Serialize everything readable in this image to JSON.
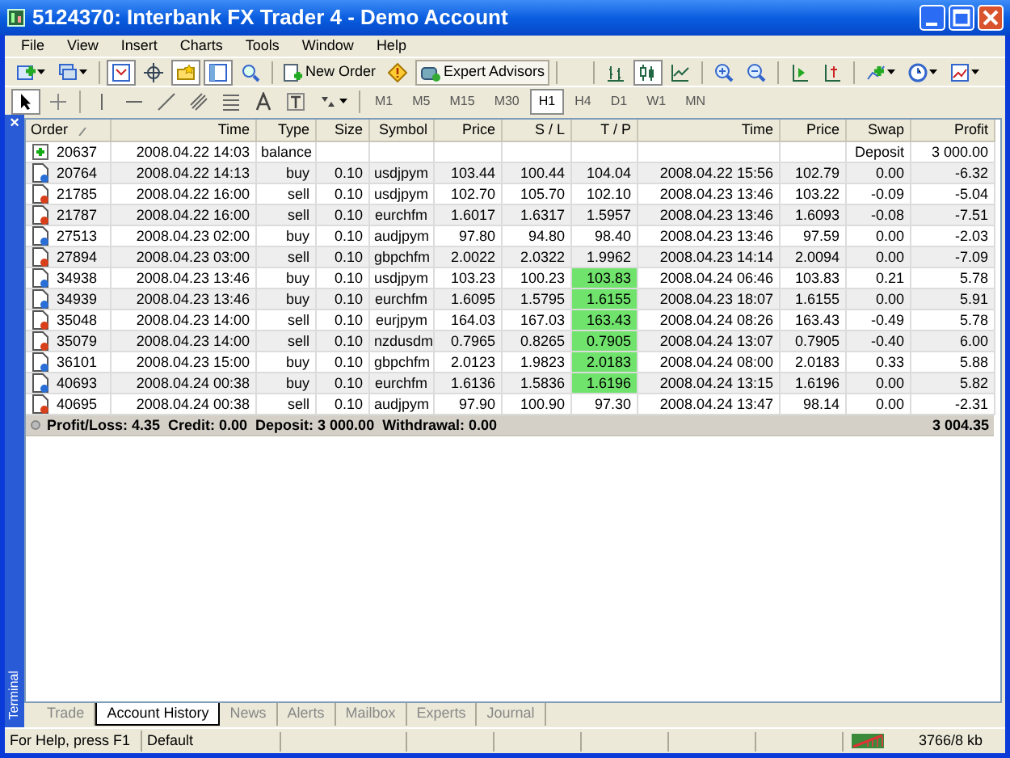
{
  "window": {
    "title": "5124370: Interbank FX Trader 4 - Demo Account"
  },
  "menu": [
    "File",
    "View",
    "Insert",
    "Charts",
    "Tools",
    "Window",
    "Help"
  ],
  "toolbar": {
    "new_order": "New Order",
    "expert_advisors": "Expert Advisors",
    "chart_modes": [
      {
        "selected": false
      },
      {
        "selected": true
      },
      {
        "selected": false
      }
    ],
    "cursor_tools": [
      {
        "selected": true
      },
      {
        "selected": false
      }
    ],
    "timeframes": [
      {
        "label": "M1",
        "selected": false
      },
      {
        "label": "M5",
        "selected": false
      },
      {
        "label": "M15",
        "selected": false
      },
      {
        "label": "M30",
        "selected": false
      },
      {
        "label": "H1",
        "selected": true
      },
      {
        "label": "H4",
        "selected": false
      },
      {
        "label": "D1",
        "selected": false
      },
      {
        "label": "W1",
        "selected": false
      },
      {
        "label": "MN",
        "selected": false
      }
    ]
  },
  "terminal": {
    "label": "Terminal",
    "close": "×",
    "columns": [
      {
        "label": "Order",
        "sorted": true
      },
      {
        "label": "Time",
        "sorted": false
      },
      {
        "label": "Type",
        "sorted": false
      },
      {
        "label": "Size",
        "sorted": false
      },
      {
        "label": "Symbol",
        "sorted": false
      },
      {
        "label": "Price",
        "sorted": false
      },
      {
        "label": "S / L",
        "sorted": false
      },
      {
        "label": "T / P",
        "sorted": false
      },
      {
        "label": "Time",
        "sorted": false
      },
      {
        "label": "Price",
        "sorted": false
      },
      {
        "label": "Swap",
        "sorted": false
      },
      {
        "label": "Profit",
        "sorted": false
      }
    ],
    "rows": [
      {
        "kind": "balance",
        "order": "20637",
        "time": "2008.04.22 14:03",
        "type": "balance",
        "swap": "Deposit",
        "profit": "3 000.00"
      },
      {
        "kind": "buy",
        "tp_hit": false,
        "order": "20764",
        "time": "2008.04.22 14:13",
        "type": "buy",
        "size": "0.10",
        "symbol": "usdjpym",
        "price": "103.44",
        "sl": "100.44",
        "tp": "104.04",
        "close_time": "2008.04.22 15:56",
        "close_price": "102.79",
        "swap": "0.00",
        "profit": "-6.32"
      },
      {
        "kind": "sell",
        "tp_hit": false,
        "order": "21785",
        "time": "2008.04.22 16:00",
        "type": "sell",
        "size": "0.10",
        "symbol": "usdjpym",
        "price": "102.70",
        "sl": "105.70",
        "tp": "102.10",
        "close_time": "2008.04.23 13:46",
        "close_price": "103.22",
        "swap": "-0.09",
        "profit": "-5.04"
      },
      {
        "kind": "sell",
        "tp_hit": false,
        "order": "21787",
        "time": "2008.04.22 16:00",
        "type": "sell",
        "size": "0.10",
        "symbol": "eurchfm",
        "price": "1.6017",
        "sl": "1.6317",
        "tp": "1.5957",
        "close_time": "2008.04.23 13:46",
        "close_price": "1.6093",
        "swap": "-0.08",
        "profit": "-7.51"
      },
      {
        "kind": "buy",
        "tp_hit": false,
        "order": "27513",
        "time": "2008.04.23 02:00",
        "type": "buy",
        "size": "0.10",
        "symbol": "audjpym",
        "price": "97.80",
        "sl": "94.80",
        "tp": "98.40",
        "close_time": "2008.04.23 13:46",
        "close_price": "97.59",
        "swap": "0.00",
        "profit": "-2.03"
      },
      {
        "kind": "sell",
        "tp_hit": false,
        "order": "27894",
        "time": "2008.04.23 03:00",
        "type": "sell",
        "size": "0.10",
        "symbol": "gbpchfm",
        "price": "2.0022",
        "sl": "2.0322",
        "tp": "1.9962",
        "close_time": "2008.04.23 14:14",
        "close_price": "2.0094",
        "swap": "0.00",
        "profit": "-7.09"
      },
      {
        "kind": "buy",
        "tp_hit": true,
        "order": "34938",
        "time": "2008.04.23 13:46",
        "type": "buy",
        "size": "0.10",
        "symbol": "usdjpym",
        "price": "103.23",
        "sl": "100.23",
        "tp": "103.83",
        "close_time": "2008.04.24 06:46",
        "close_price": "103.83",
        "swap": "0.21",
        "profit": "5.78"
      },
      {
        "kind": "buy",
        "tp_hit": true,
        "order": "34939",
        "time": "2008.04.23 13:46",
        "type": "buy",
        "size": "0.10",
        "symbol": "eurchfm",
        "price": "1.6095",
        "sl": "1.5795",
        "tp": "1.6155",
        "close_time": "2008.04.23 18:07",
        "close_price": "1.6155",
        "swap": "0.00",
        "profit": "5.91"
      },
      {
        "kind": "sell",
        "tp_hit": true,
        "order": "35048",
        "time": "2008.04.23 14:00",
        "type": "sell",
        "size": "0.10",
        "symbol": "eurjpym",
        "price": "164.03",
        "sl": "167.03",
        "tp": "163.43",
        "close_time": "2008.04.24 08:26",
        "close_price": "163.43",
        "swap": "-0.49",
        "profit": "5.78"
      },
      {
        "kind": "sell",
        "tp_hit": true,
        "order": "35079",
        "time": "2008.04.23 14:00",
        "type": "sell",
        "size": "0.10",
        "symbol": "nzdusdm",
        "price": "0.7965",
        "sl": "0.8265",
        "tp": "0.7905",
        "close_time": "2008.04.24 13:07",
        "close_price": "0.7905",
        "swap": "-0.40",
        "profit": "6.00"
      },
      {
        "kind": "buy",
        "tp_hit": true,
        "order": "36101",
        "time": "2008.04.23 15:00",
        "type": "buy",
        "size": "0.10",
        "symbol": "gbpchfm",
        "price": "2.0123",
        "sl": "1.9823",
        "tp": "2.0183",
        "close_time": "2008.04.24 08:00",
        "close_price": "2.0183",
        "swap": "0.33",
        "profit": "5.88"
      },
      {
        "kind": "buy",
        "tp_hit": true,
        "order": "40693",
        "time": "2008.04.24 00:38",
        "type": "buy",
        "size": "0.10",
        "symbol": "eurchfm",
        "price": "1.6136",
        "sl": "1.5836",
        "tp": "1.6196",
        "close_time": "2008.04.24 13:15",
        "close_price": "1.6196",
        "swap": "0.00",
        "profit": "5.82"
      },
      {
        "kind": "sell",
        "tp_hit": false,
        "order": "40695",
        "time": "2008.04.24 00:38",
        "type": "sell",
        "size": "0.10",
        "symbol": "audjpym",
        "price": "97.90",
        "sl": "100.90",
        "tp": "97.30",
        "close_time": "2008.04.24 13:47",
        "close_price": "98.14",
        "swap": "0.00",
        "profit": "-2.31"
      }
    ],
    "summary": {
      "text": "Profit/Loss: 4.35  Credit: 0.00  Deposit: 3 000.00  Withdrawal: 0.00",
      "total": "3 004.35"
    },
    "tabs": [
      {
        "label": "Trade",
        "selected": false
      },
      {
        "label": "Account History",
        "selected": true
      },
      {
        "label": "News",
        "selected": false
      },
      {
        "label": "Alerts",
        "selected": false
      },
      {
        "label": "Mailbox",
        "selected": false
      },
      {
        "label": "Experts",
        "selected": false
      },
      {
        "label": "Journal",
        "selected": false
      }
    ]
  },
  "status_bar": {
    "help": "For Help, press F1",
    "profile": "Default",
    "memory": "3766/8 kb"
  }
}
